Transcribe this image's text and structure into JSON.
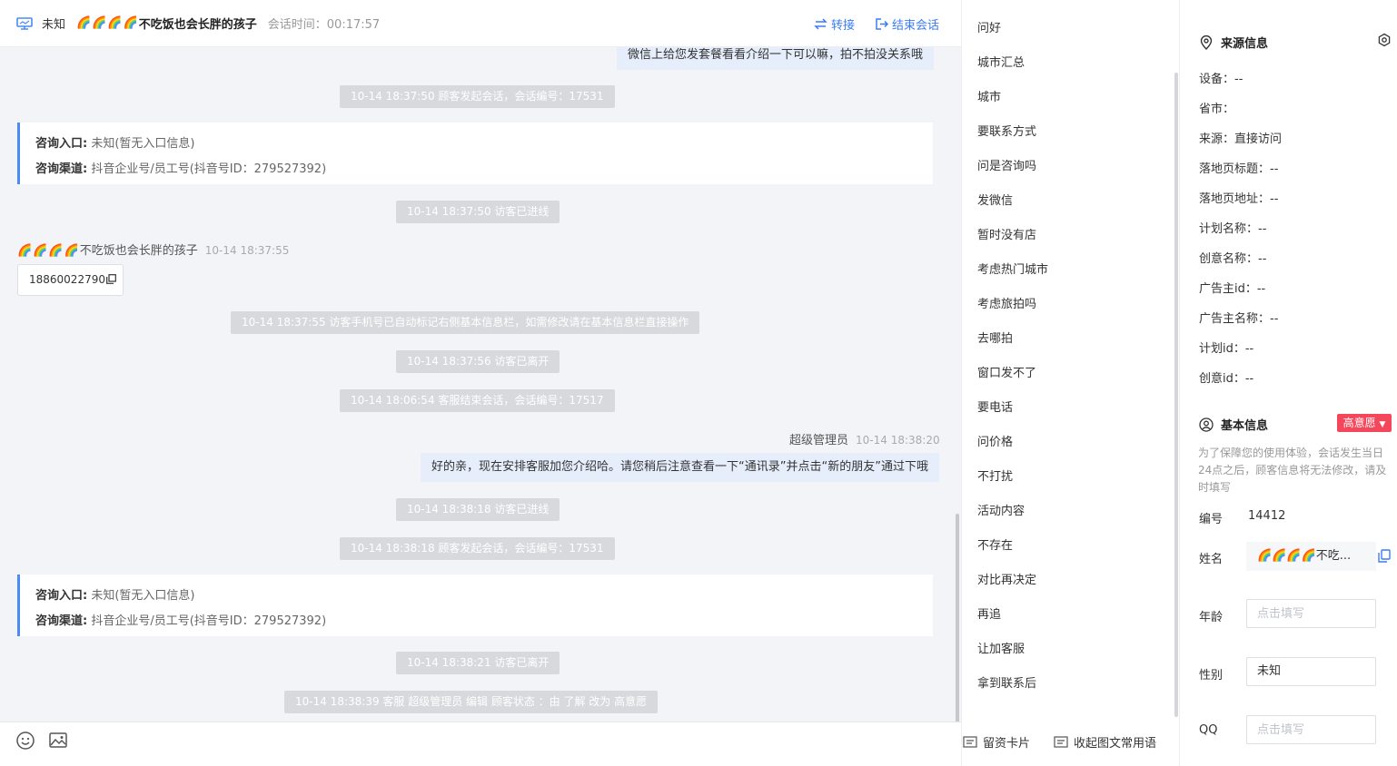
{
  "header": {
    "device_label": "未知",
    "visitor_prefix": "🌈🌈🌈🌈",
    "visitor_name": "不吃饭也会长胖的孩子",
    "session_time": "会话时间：00:17:57",
    "transfer_label": "转接",
    "end_label": "结束会话"
  },
  "messages": {
    "top_bubble": "微信上给您发套餐看看介绍一下可以嘛，拍不拍没关系哦",
    "sys1": "10-14 18:37:50 顾客发起会话，会话编号：17531",
    "card1": {
      "entry_label": "咨询入口:",
      "entry_value": "未知(暂无入口信息)",
      "channel_label": "咨询渠道:",
      "channel_value": "抖音企业号/员工号(抖音号ID：279527392)"
    },
    "sys2": "10-14 18:37:50 访客已进线",
    "visitor_prefix": "🌈🌈🌈🌈",
    "visitor_name": "不吃饭也会长胖的孩子",
    "visitor_time": "10-14 18:37:55",
    "phone": "18860022790",
    "sys3": "10-14 18:37:55 访客手机号已自动标记右侧基本信息栏，如需修改请在基本信息栏直接操作",
    "sys4": "10-14 18:37:56 访客已离开",
    "sys5": "10-14 18:06:54 客服结束会话，会话编号：17517",
    "agent_name": "超级管理员",
    "agent_time": "10-14 18:38:20",
    "agent_bubble": "好的亲，现在安排客服加您介绍哈。请您稍后注意查看一下“通讯录”并点击“新的朋友”通过下哦",
    "sys6": "10-14 18:38:18 访客已进线",
    "sys7": "10-14 18:38:18 顾客发起会话，会话编号：17531",
    "card2": {
      "entry_label": "咨询入口:",
      "entry_value": "未知(暂无入口信息)",
      "channel_label": "咨询渠道:",
      "channel_value": "抖音企业号/员工号(抖音号ID：279527392)"
    },
    "sys8": "10-14 18:38:21 访客已离开",
    "sys9": "10-14 18:38:39 客服 超级管理员 编辑 顾客状态 ：由 了解 改为 高意愿"
  },
  "quick_phrases": [
    "问好",
    "城市汇总",
    "城市",
    "要联系方式",
    "问是咨询吗",
    "发微信",
    "暂时没有店",
    "考虑热门城市",
    "考虑旅拍吗",
    "去哪拍",
    "窗口发不了",
    "要电话",
    "问价格",
    "不打扰",
    "活动内容",
    "不存在",
    "对比再决定",
    "再追",
    "让加客服",
    "拿到联系后"
  ],
  "footer": {
    "card_label": "留资卡片",
    "collapse_label": "收起图文常用语"
  },
  "source_info": {
    "title": "来源信息",
    "rows": [
      "设备：--",
      "省市：",
      "来源：直接访问",
      "落地页标题：--",
      "落地页地址：--",
      "计划名称：--",
      "创意名称：--",
      "广告主id：--",
      "广告主名称：--",
      "计划id：--",
      "创意id：--"
    ]
  },
  "basic_info": {
    "title": "基本信息",
    "badge": "高意愿",
    "note": "为了保障您的使用体验，会话发生当日24点之后，顾客信息将无法修改，请及时填写",
    "id_label": "编号",
    "id_value": "14412",
    "name_label": "姓名",
    "name_value": "🌈🌈🌈🌈不吃...",
    "age_label": "年龄",
    "age_placeholder": "点击填写",
    "gender_label": "性别",
    "gender_value": "未知",
    "qq_label": "QQ",
    "qq_placeholder": "点击填写"
  },
  "colors": {
    "accent": "#3b7cf5",
    "badge": "#f5475b",
    "system_msg": "#d8d9dc",
    "agent_bubble": "#e6eefc"
  }
}
